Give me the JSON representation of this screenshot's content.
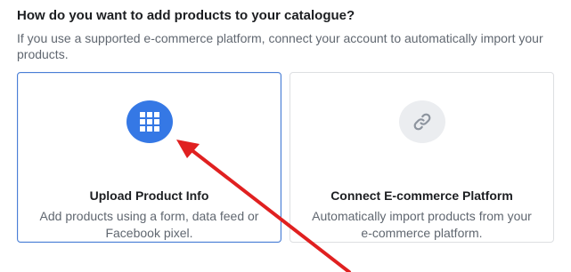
{
  "header": {
    "title": "How do you want to add products to your catalogue?",
    "description": "If you use a supported e-commerce platform, connect your account to automatically import your products."
  },
  "options": [
    {
      "title": "Upload Product Info",
      "description": "Add products using a form, data feed or Facebook pixel.",
      "icon": "grid-icon",
      "selected": true
    },
    {
      "title": "Connect E-commerce Platform",
      "description": "Automatically import products from your e-commerce platform.",
      "icon": "link-icon",
      "selected": false
    }
  ],
  "colors": {
    "accent": "#3578e5",
    "selected_border": "#4a7fd6",
    "annotation_arrow": "#e02020"
  }
}
